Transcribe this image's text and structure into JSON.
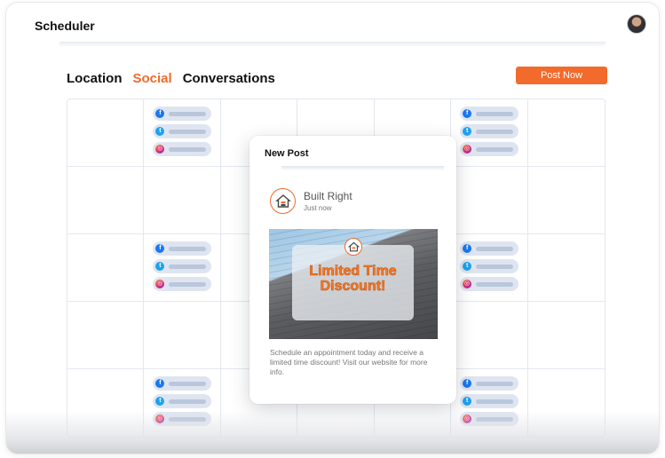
{
  "app": {
    "title": "Scheduler"
  },
  "tabs": [
    {
      "label": "Location",
      "active": false
    },
    {
      "label": "Social",
      "active": true
    },
    {
      "label": "Conversations",
      "active": false
    }
  ],
  "toolbar": {
    "post_now_label": "Post Now"
  },
  "colors": {
    "accent": "#f26a2c",
    "facebook": "#1877f2",
    "twitter": "#1da1f2"
  },
  "calendar": {
    "rows": 5,
    "columns": 7,
    "chip_icons": [
      "facebook-icon",
      "twitter-icon",
      "instagram-icon"
    ]
  },
  "modal": {
    "title": "New Post",
    "brand_name": "Built Right",
    "timestamp": "Just now",
    "promo_text": "Limited Time Discount!",
    "caption": "Schedule an appointment today and receive a limited time discount! Visit our website for more info."
  }
}
